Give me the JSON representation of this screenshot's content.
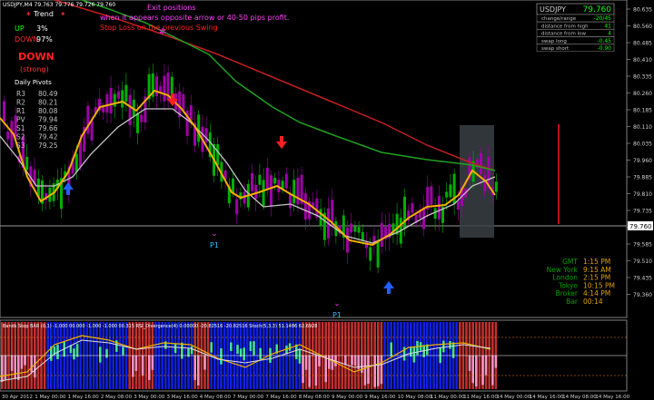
{
  "chart": {
    "title": "USDJPY,M4  79.763 79.776 79.726 79.760",
    "annotation_line1": "Exit positions",
    "annotation_line2": "when it appears opposite arrow or  40-50 pips profit.",
    "annotation_line3": "Stop Loss on the previous Swing",
    "current_price_tag": "79.760",
    "price_ticks": [
      "80.635",
      "80.560",
      "80.485",
      "80.410",
      "80.335",
      "80.260",
      "80.185",
      "80.110",
      "80.035",
      "79.960",
      "79.885",
      "79.810",
      "79.735",
      "79.660",
      "79.585",
      "79.510",
      "79.435",
      "79.360"
    ],
    "time_ticks": [
      "30 Apr 2012",
      "1 May 00:00",
      "1 May 16:00",
      "2 May 08:00",
      "3 May 00:00",
      "3 May 16:00",
      "4 May 08:00",
      "7 May 00:00",
      "7 May 16:00",
      "8 May 08:00",
      "9 May 00:00",
      "9 May 16:00",
      "10 May 08:00",
      "11 May 00:00",
      "11 May 16:00",
      "14 May 00:00",
      "14 May 16:00",
      "14 May 08:00",
      "14 May 16:00"
    ],
    "pivot_markers": [
      "P1",
      "P1",
      "P1"
    ]
  },
  "trend_panel": {
    "title": "Trend",
    "up_label": "UP",
    "up_value": "3%",
    "down_label": "DOWN",
    "down_value": "97%",
    "signal": "DOWN",
    "strength": "(strong)",
    "pivots_title": "Daily Pivots",
    "pivots": [
      {
        "label": "R3",
        "value": "80.49"
      },
      {
        "label": "R2",
        "value": "80.21"
      },
      {
        "label": "R1",
        "value": "80.08"
      },
      {
        "label": "PV",
        "value": "79.94"
      },
      {
        "label": "S1",
        "value": "79.66"
      },
      {
        "label": "S2",
        "value": "79.42"
      },
      {
        "label": "S3",
        "value": "79.25"
      }
    ]
  },
  "info_panel": {
    "symbol": "USDJPY",
    "price": "79.760",
    "rows": [
      {
        "label": "change/range",
        "value": "-20/45"
      },
      {
        "label": "distance from high",
        "value": "41"
      },
      {
        "label": "distance from low",
        "value": "4"
      },
      {
        "label": "swap long",
        "value": "-0.45"
      },
      {
        "label": "swap short",
        "value": "-0.90"
      }
    ]
  },
  "clock": [
    {
      "label": "GMT",
      "value": "1:15 PM"
    },
    {
      "label": "New York",
      "value": "9:15 AM"
    },
    {
      "label": "London",
      "value": "2:15 PM"
    },
    {
      "label": "Tokyo",
      "value": "10:15 PM"
    },
    {
      "label": "Broker",
      "value": "4:14 PM"
    },
    {
      "label": "Bar",
      "value": "00:14"
    }
  ],
  "sub_window": {
    "title": "Bands Stop BAR (0,1) -1.000 00.000 -1.000 -1.000 00.315 RSI_Divergence(4) 0.00000 -20.82516 -20.82516 Stoch(5,3,3) 51.1486 62.6928"
  },
  "colors": {
    "background": "#000000",
    "bull_candle": "#00c000",
    "bear_candle": "#b000b0",
    "ma_fast": "#f0b000",
    "ma_mid": "#c8c8c8",
    "ma_slow_red": "#c02020",
    "ma_slow_green": "#20a020",
    "up_arrow": "#2060ff",
    "down_arrow": "#ff2020",
    "grid": "#404040"
  }
}
